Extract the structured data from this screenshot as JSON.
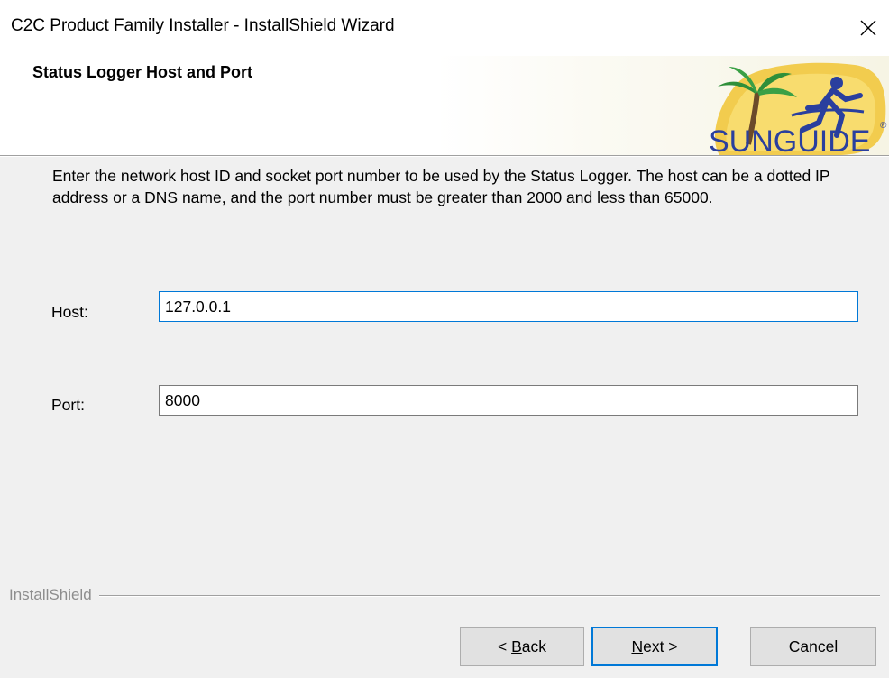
{
  "window": {
    "title": "C2C Product Family Installer - InstallShield Wizard"
  },
  "header": {
    "title": "Status Logger Host and Port",
    "logo_text": "SUNGUIDE",
    "logo_mark": "®"
  },
  "main": {
    "description": "Enter the network host ID and socket port number to be used by the Status Logger.  The host can be a dotted IP address or a DNS name, and the port number must be greater than 2000 and less than 65000.",
    "host_label": "Host:",
    "host_value": "127.0.0.1",
    "port_label": "Port:",
    "port_value": "8000"
  },
  "footer": {
    "brand": "InstallShield",
    "back_prefix": "< ",
    "back_mnemonic": "B",
    "back_rest": "ack",
    "next_mnemonic": "N",
    "next_rest": "ext >",
    "cancel_label": "Cancel"
  },
  "colors": {
    "focus_border": "#0078d7",
    "button_face": "#e1e1e1",
    "dialog_bg": "#f0f0f0"
  },
  "icons": {
    "close": "close-icon",
    "logo": "sunguide-logo"
  }
}
